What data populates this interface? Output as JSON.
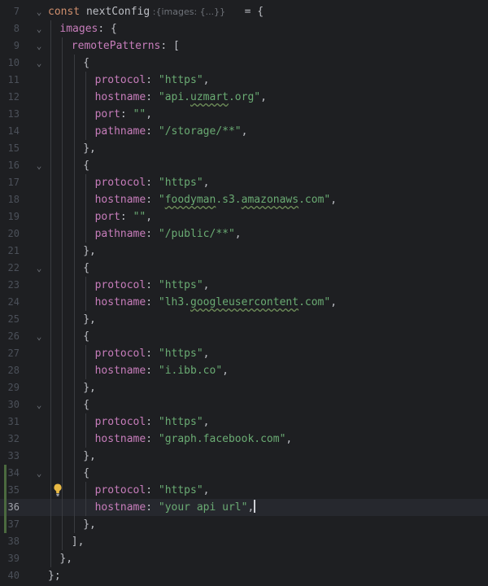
{
  "editor": {
    "lines": [
      {
        "n": "7",
        "fold": "⌄",
        "indent": 0,
        "tokens": [
          [
            "kw",
            "const "
          ],
          [
            "fn",
            "nextConfig"
          ],
          [
            "hint",
            " :{images: {...}}"
          ],
          [
            "punc",
            "   = {"
          ]
        ]
      },
      {
        "n": "8",
        "fold": "⌄",
        "indent": 1,
        "tokens": [
          [
            "prop",
            "images"
          ],
          [
            "punc",
            ": {"
          ]
        ]
      },
      {
        "n": "9",
        "fold": "⌄",
        "indent": 2,
        "tokens": [
          [
            "prop",
            "remotePatterns"
          ],
          [
            "punc",
            ": ["
          ]
        ]
      },
      {
        "n": "10",
        "fold": "⌄",
        "indent": 3,
        "tokens": [
          [
            "punc",
            "{"
          ]
        ]
      },
      {
        "n": "11",
        "fold": "",
        "indent": 4,
        "tokens": [
          [
            "prop",
            "protocol"
          ],
          [
            "punc",
            ": "
          ],
          [
            "str",
            "\"https\""
          ],
          [
            "punc",
            ","
          ]
        ]
      },
      {
        "n": "12",
        "fold": "",
        "indent": 4,
        "tokens": [
          [
            "prop",
            "hostname"
          ],
          [
            "punc",
            ": "
          ],
          [
            "str",
            "\"api."
          ],
          [
            "strtypo",
            "uzmart"
          ],
          [
            "str",
            ".org\""
          ],
          [
            "punc",
            ","
          ]
        ]
      },
      {
        "n": "13",
        "fold": "",
        "indent": 4,
        "tokens": [
          [
            "prop",
            "port"
          ],
          [
            "punc",
            ": "
          ],
          [
            "str",
            "\"\""
          ],
          [
            "punc",
            ","
          ]
        ]
      },
      {
        "n": "14",
        "fold": "",
        "indent": 4,
        "tokens": [
          [
            "prop",
            "pathname"
          ],
          [
            "punc",
            ": "
          ],
          [
            "str",
            "\"/storage/**\""
          ],
          [
            "punc",
            ","
          ]
        ]
      },
      {
        "n": "15",
        "fold": "",
        "indent": 3,
        "tokens": [
          [
            "punc",
            "},"
          ]
        ]
      },
      {
        "n": "16",
        "fold": "⌄",
        "indent": 3,
        "tokens": [
          [
            "punc",
            "{"
          ]
        ]
      },
      {
        "n": "17",
        "fold": "",
        "indent": 4,
        "tokens": [
          [
            "prop",
            "protocol"
          ],
          [
            "punc",
            ": "
          ],
          [
            "str",
            "\"https\""
          ],
          [
            "punc",
            ","
          ]
        ]
      },
      {
        "n": "18",
        "fold": "",
        "indent": 4,
        "tokens": [
          [
            "prop",
            "hostname"
          ],
          [
            "punc",
            ": "
          ],
          [
            "str",
            "\""
          ],
          [
            "strtypo",
            "foodyman"
          ],
          [
            "str",
            ".s3."
          ],
          [
            "strtypo",
            "amazonaws"
          ],
          [
            "str",
            ".com\""
          ],
          [
            "punc",
            ","
          ]
        ]
      },
      {
        "n": "19",
        "fold": "",
        "indent": 4,
        "tokens": [
          [
            "prop",
            "port"
          ],
          [
            "punc",
            ": "
          ],
          [
            "str",
            "\"\""
          ],
          [
            "punc",
            ","
          ]
        ]
      },
      {
        "n": "20",
        "fold": "",
        "indent": 4,
        "tokens": [
          [
            "prop",
            "pathname"
          ],
          [
            "punc",
            ": "
          ],
          [
            "str",
            "\"/public/**\""
          ],
          [
            "punc",
            ","
          ]
        ]
      },
      {
        "n": "21",
        "fold": "",
        "indent": 3,
        "tokens": [
          [
            "punc",
            "},"
          ]
        ]
      },
      {
        "n": "22",
        "fold": "⌄",
        "indent": 3,
        "tokens": [
          [
            "punc",
            "{"
          ]
        ]
      },
      {
        "n": "23",
        "fold": "",
        "indent": 4,
        "tokens": [
          [
            "prop",
            "protocol"
          ],
          [
            "punc",
            ": "
          ],
          [
            "str",
            "\"https\""
          ],
          [
            "punc",
            ","
          ]
        ]
      },
      {
        "n": "24",
        "fold": "",
        "indent": 4,
        "tokens": [
          [
            "prop",
            "hostname"
          ],
          [
            "punc",
            ": "
          ],
          [
            "str",
            "\"lh3."
          ],
          [
            "strtypo",
            "googleusercontent"
          ],
          [
            "str",
            ".com\""
          ],
          [
            "punc",
            ","
          ]
        ]
      },
      {
        "n": "25",
        "fold": "",
        "indent": 3,
        "tokens": [
          [
            "punc",
            "},"
          ]
        ]
      },
      {
        "n": "26",
        "fold": "⌄",
        "indent": 3,
        "tokens": [
          [
            "punc",
            "{"
          ]
        ]
      },
      {
        "n": "27",
        "fold": "",
        "indent": 4,
        "tokens": [
          [
            "prop",
            "protocol"
          ],
          [
            "punc",
            ": "
          ],
          [
            "str",
            "\"https\""
          ],
          [
            "punc",
            ","
          ]
        ]
      },
      {
        "n": "28",
        "fold": "",
        "indent": 4,
        "tokens": [
          [
            "prop",
            "hostname"
          ],
          [
            "punc",
            ": "
          ],
          [
            "str",
            "\"i.ibb.co\""
          ],
          [
            "punc",
            ","
          ]
        ]
      },
      {
        "n": "29",
        "fold": "",
        "indent": 3,
        "tokens": [
          [
            "punc",
            "},"
          ]
        ]
      },
      {
        "n": "30",
        "fold": "⌄",
        "indent": 3,
        "tokens": [
          [
            "punc",
            "{"
          ]
        ]
      },
      {
        "n": "31",
        "fold": "",
        "indent": 4,
        "tokens": [
          [
            "prop",
            "protocol"
          ],
          [
            "punc",
            ": "
          ],
          [
            "str",
            "\"https\""
          ],
          [
            "punc",
            ","
          ]
        ]
      },
      {
        "n": "32",
        "fold": "",
        "indent": 4,
        "tokens": [
          [
            "prop",
            "hostname"
          ],
          [
            "punc",
            ": "
          ],
          [
            "str",
            "\"graph.facebook.com\""
          ],
          [
            "punc",
            ","
          ]
        ]
      },
      {
        "n": "33",
        "fold": "",
        "indent": 3,
        "tokens": [
          [
            "punc",
            "},"
          ]
        ]
      },
      {
        "n": "34",
        "fold": "⌄",
        "indent": 3,
        "tokens": [
          [
            "punc",
            "{"
          ]
        ],
        "changed": true
      },
      {
        "n": "35",
        "fold": "",
        "indent": 4,
        "tokens": [
          [
            "prop",
            "protocol"
          ],
          [
            "punc",
            ": "
          ],
          [
            "str",
            "\"https\""
          ],
          [
            "punc",
            ","
          ]
        ],
        "changed": true,
        "bulb": true
      },
      {
        "n": "36",
        "fold": "",
        "indent": 4,
        "tokens": [
          [
            "prop",
            "hostname"
          ],
          [
            "punc",
            ": "
          ],
          [
            "str",
            "\"your api url\""
          ],
          [
            "punc",
            ","
          ],
          [
            "caret",
            ""
          ]
        ],
        "changed": true,
        "current": true
      },
      {
        "n": "37",
        "fold": "",
        "indent": 3,
        "tokens": [
          [
            "punc",
            "},"
          ]
        ],
        "changed": true
      },
      {
        "n": "38",
        "fold": "",
        "indent": 2,
        "tokens": [
          [
            "punc",
            "],"
          ]
        ]
      },
      {
        "n": "39",
        "fold": "",
        "indent": 1,
        "tokens": [
          [
            "punc",
            "},"
          ]
        ]
      },
      {
        "n": "40",
        "fold": "",
        "indent": 0,
        "tokens": [
          [
            "punc",
            "};"
          ]
        ]
      }
    ]
  },
  "colors": {
    "background": "#1e1f22",
    "keyword": "#cf8e6d",
    "property": "#c77dbb",
    "string": "#6aab73",
    "current_line": "#26282e",
    "change_marker": "#4b6a3f"
  },
  "icons": {
    "fold": "chevron-down-icon",
    "intention": "lightbulb-icon"
  }
}
